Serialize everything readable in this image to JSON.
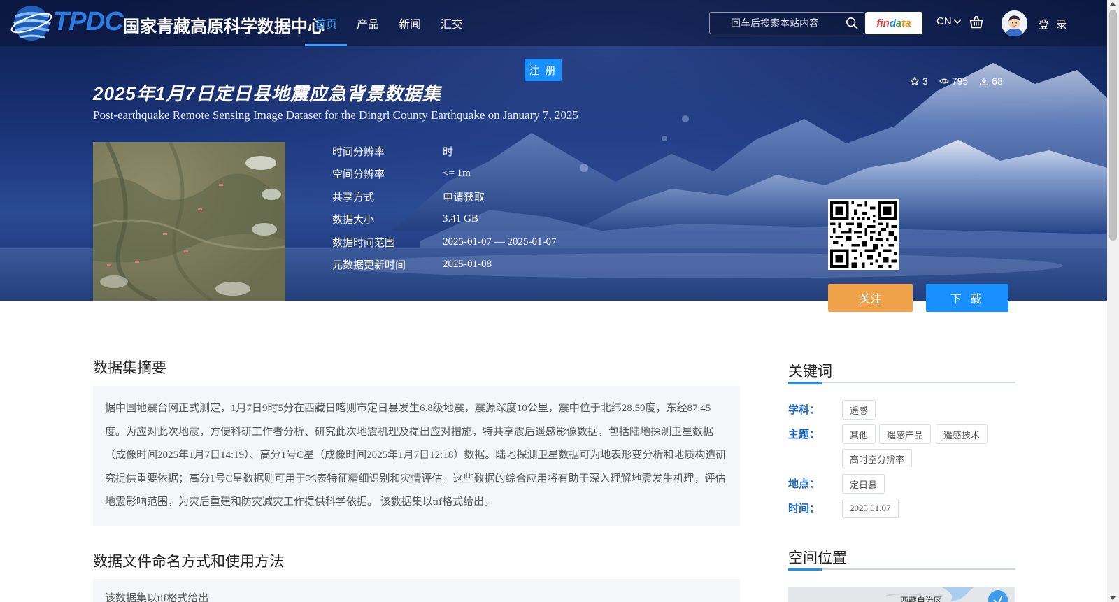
{
  "site": {
    "logo_text": "TPDC",
    "name": "国家青藏高原科学数据中心"
  },
  "nav": {
    "items": [
      {
        "label": "首页",
        "active": true
      },
      {
        "label": "产品"
      },
      {
        "label": "新闻"
      },
      {
        "label": "汇交"
      }
    ]
  },
  "search": {
    "placeholder": "回车后搜索本站内容"
  },
  "findata": {
    "part1": "fin",
    "part2": "d",
    "part3": "a",
    "part4": "ta"
  },
  "lang": "CN",
  "login": "登 录",
  "register": "注 册",
  "dataset": {
    "title_cn": "2025年1月7日定日县地震应急背景数据集",
    "title_en": "Post-earthquake Remote Sensing Image Dataset for the Dingri County Earthquake on January 7, 2025",
    "stats": {
      "stars": "3",
      "views": "795",
      "downloads": "68"
    },
    "meta": [
      {
        "label": "时间分辨率",
        "value": "时"
      },
      {
        "label": "空间分辨率",
        "value": "<= 1m"
      },
      {
        "label": "共享方式",
        "value": "申请获取"
      },
      {
        "label": "数据大小",
        "value": "3.41 GB"
      },
      {
        "label": "数据时间范围",
        "value": "2025-01-07 — 2025-01-07"
      },
      {
        "label": "元数据更新时间",
        "value": "2025-01-08"
      }
    ]
  },
  "actions": {
    "follow": "关注",
    "download": "下 载"
  },
  "abstract": {
    "title": "数据集摘要",
    "text": "据中国地震台网正式测定，1月7日9时5分在西藏日喀则市定日县发生6.8级地震，震源深度10公里，震中位于北纬28.50度，东经87.45度。为应对此次地震，方便科研工作者分析、研究此次地震机理及提出应对措施，特共享震后遥感影像数据，包括陆地探测卫星数据（成像时间2025年1月7日14:19）、高分1号C星（成像时间2025年1月7日12:18）数据。陆地探测卫星数据可为地表形变分析和地质构造研究提供重要依据；高分1号C星数据则可用于地表特征精细识别和灾情评估。这些数据的综合应用将有助于深入理解地震发生机理，评估地震影响范围，为灾后重建和防灾减灾工作提供科学依据。 该数据集以tif格式给出。"
  },
  "naming": {
    "title": "数据文件命名方式和使用方法",
    "text": "该数据集以tif格式给出"
  },
  "keywords": {
    "title": "关键词",
    "subject_label": "学科：",
    "subjects": [
      "遥感"
    ],
    "theme_label": "主题：",
    "themes": [
      "其他",
      "遥感产品",
      "遥感技术",
      "高时空分辨率"
    ],
    "place_label": "地点：",
    "places": [
      "定日县"
    ],
    "time_label": "时间：",
    "times": [
      "2025.01.07"
    ]
  },
  "location": {
    "title": "空间位置",
    "map_label": "西藏自治区"
  }
}
